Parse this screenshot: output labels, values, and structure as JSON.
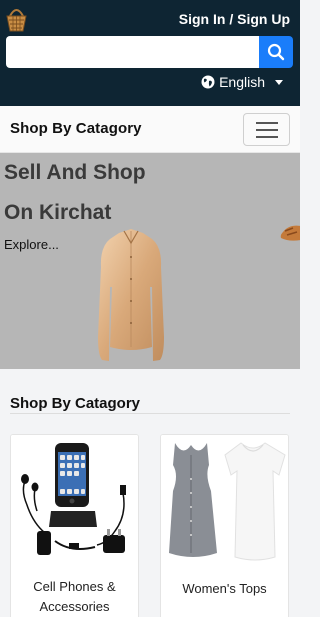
{
  "header": {
    "logo_icon": "basket-logo-icon",
    "signin_label": "Sign In / Sign Up",
    "search": {
      "placeholder": "",
      "value": "",
      "button_icon": "search-icon",
      "button_color": "#1a7dfa"
    },
    "language": {
      "icon": "globe-icon",
      "selected": "English"
    },
    "background": "#0e2533"
  },
  "nav": {
    "title": "Shop By Catagory",
    "menu_icon": "hamburger-menu-icon"
  },
  "hero": {
    "line1": "Sell And Shop",
    "line2": "On Kirchat",
    "explore": "Explore...",
    "image": "satin-blouse-image",
    "next_slide_image": "sandal-image"
  },
  "section": {
    "title": "Shop By Catagory",
    "cards": [
      {
        "label": "Cell Phones & Accessories",
        "image": "cell-phone-accessories-image"
      },
      {
        "label": "Women's Tops",
        "image": "womens-tops-image"
      }
    ]
  }
}
